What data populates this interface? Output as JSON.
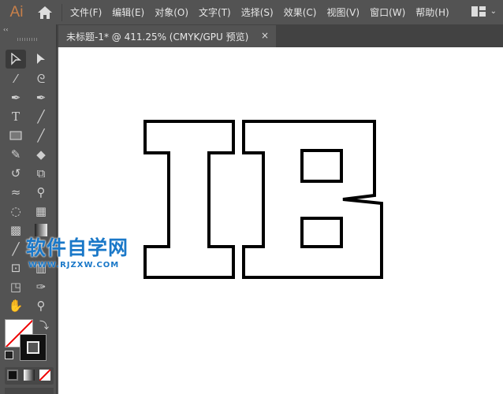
{
  "app": {
    "logo": "Ai"
  },
  "menu": [
    "文件(F)",
    "编辑(E)",
    "对象(O)",
    "文字(T)",
    "选择(S)",
    "效果(C)",
    "视图(V)",
    "窗口(W)",
    "帮助(H)"
  ],
  "tab": {
    "title": "未标题-1* @ 411.25% (CMYK/GPU 预览)",
    "close": "×",
    "collapse": "‹‹"
  },
  "watermark": {
    "title": "软件自学网",
    "url": "WWW.RJZXW.COM"
  },
  "colors": {
    "accent": "#c8804a",
    "canvas": "#ffffff",
    "panel": "#535353",
    "stroke": "#000000"
  }
}
